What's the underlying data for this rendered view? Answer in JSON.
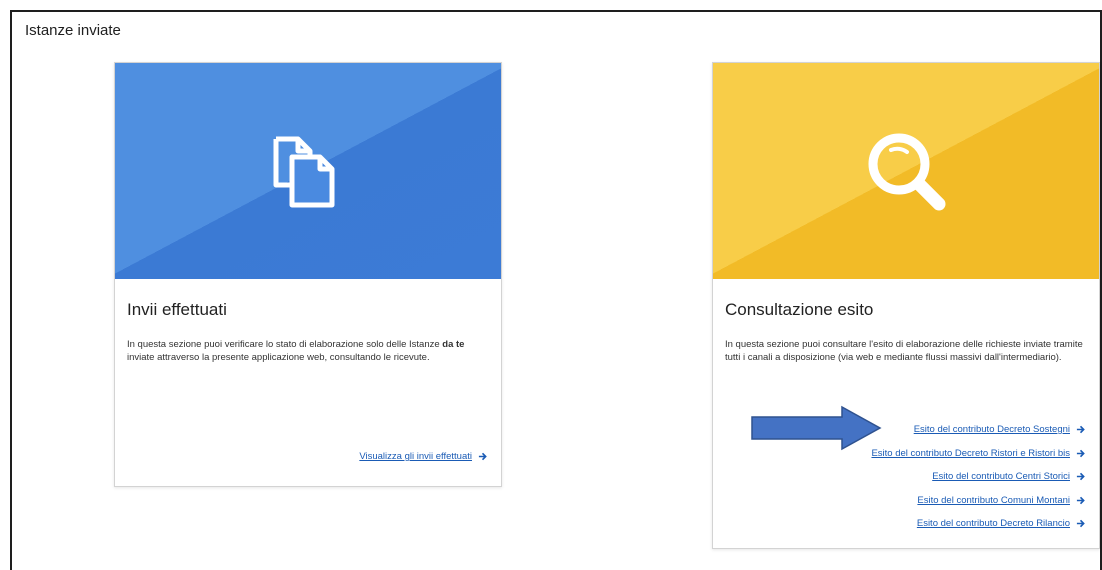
{
  "section": {
    "title": "Istanze inviate"
  },
  "cards": [
    {
      "title": "Invii effettuati",
      "icon": "copy-documents-icon",
      "color": "#4a8ae0",
      "description_1": "In questa sezione puoi verificare lo stato di elaborazione solo delle Istanze",
      "description_bold": "da te",
      "description_2": " inviate attraverso la presente applicazione web, consultando le ricevute.",
      "links": [
        {
          "label": "Visualizza gli invii effettuati"
        }
      ]
    },
    {
      "title": "Consultazione esito",
      "icon": "magnifier-icon",
      "color": "#f6c53c",
      "description": "In questa sezione puoi consultare l'esito di elaborazione delle richieste inviate tramite tutti i canali a disposizione (via web e mediante flussi massivi dall'intermediario).",
      "links": [
        {
          "label": "Esito del contributo Decreto Sostegni"
        },
        {
          "label": "Esito del contributo Decreto Ristori e Ristori bis"
        },
        {
          "label": "Esito del contributo Centri Storici"
        },
        {
          "label": "Esito del contributo Comuni Montani"
        },
        {
          "label": "Esito del contributo Decreto Rilancio"
        }
      ]
    }
  ],
  "colors": {
    "link": "#1a5bb5",
    "annotation_arrow": "#4472c4"
  }
}
